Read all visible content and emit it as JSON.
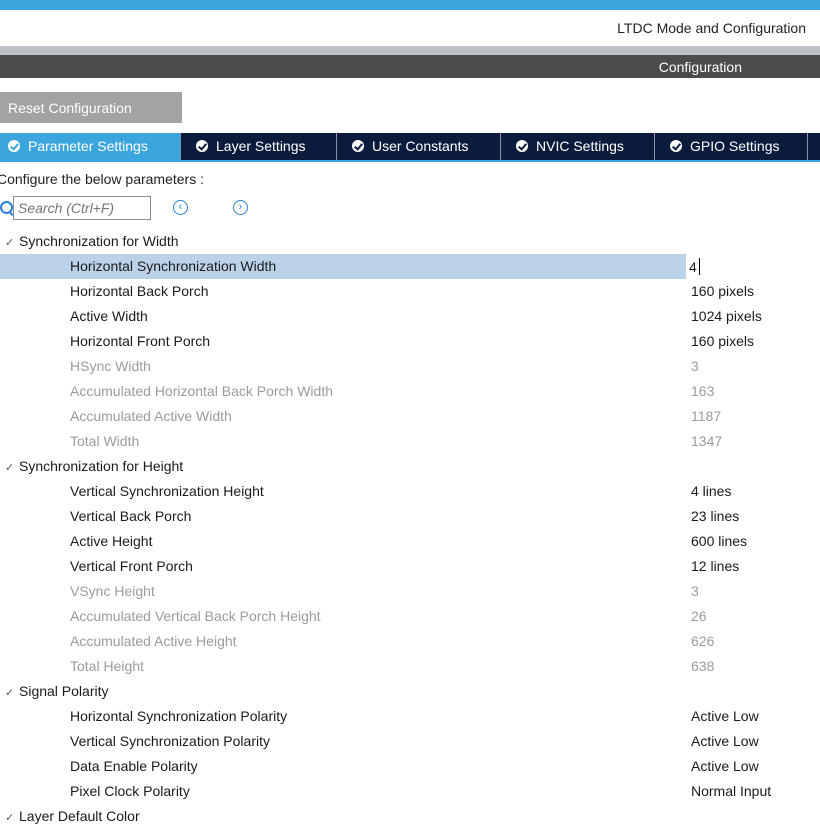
{
  "header": {
    "mode_title": "LTDC Mode and Configuration",
    "config_title": "Configuration"
  },
  "toolbar": {
    "reset_label": "Reset Configuration"
  },
  "tabs": [
    {
      "label": "Parameter Settings",
      "active": true
    },
    {
      "label": "Layer Settings",
      "active": false
    },
    {
      "label": "User Constants",
      "active": false
    },
    {
      "label": "NVIC Settings",
      "active": false
    },
    {
      "label": "GPIO Settings",
      "active": false
    }
  ],
  "configure_text": "Configure the below parameters :",
  "search": {
    "placeholder": "Search (Ctrl+F)"
  },
  "sections": [
    {
      "title": "Synchronization for Width",
      "params": [
        {
          "label": "Horizontal Synchronization Width",
          "value": "4",
          "editable": true,
          "selected": true
        },
        {
          "label": "Horizontal Back Porch",
          "value": "160 pixels",
          "editable": true
        },
        {
          "label": "Active Width",
          "value": "1024 pixels",
          "editable": true
        },
        {
          "label": "Horizontal Front Porch",
          "value": "160 pixels",
          "editable": true
        },
        {
          "label": "HSync Width",
          "value": "3",
          "editable": false
        },
        {
          "label": "Accumulated Horizontal Back Porch Width",
          "value": "163",
          "editable": false
        },
        {
          "label": "Accumulated Active Width",
          "value": "1187",
          "editable": false
        },
        {
          "label": "Total Width",
          "value": "1347",
          "editable": false
        }
      ]
    },
    {
      "title": "Synchronization for Height",
      "params": [
        {
          "label": "Vertical Synchronization Height",
          "value": "4 lines",
          "editable": true
        },
        {
          "label": "Vertical Back Porch",
          "value": "23 lines",
          "editable": true
        },
        {
          "label": "Active Height",
          "value": "600 lines",
          "editable": true
        },
        {
          "label": "Vertical Front Porch",
          "value": "12 lines",
          "editable": true
        },
        {
          "label": "VSync Height",
          "value": "3",
          "editable": false
        },
        {
          "label": "Accumulated Vertical Back Porch Height",
          "value": "26",
          "editable": false
        },
        {
          "label": "Accumulated Active Height",
          "value": "626",
          "editable": false
        },
        {
          "label": "Total Height",
          "value": "638",
          "editable": false
        }
      ]
    },
    {
      "title": "Signal Polarity",
      "params": [
        {
          "label": "Horizontal Synchronization Polarity",
          "value": "Active Low",
          "editable": true
        },
        {
          "label": "Vertical Synchronization Polarity",
          "value": "Active Low",
          "editable": true
        },
        {
          "label": "Data Enable Polarity",
          "value": "Active Low",
          "editable": true
        },
        {
          "label": "Pixel Clock Polarity",
          "value": "Normal Input",
          "editable": true
        }
      ]
    },
    {
      "title": "Layer Default Color",
      "params": []
    }
  ]
}
